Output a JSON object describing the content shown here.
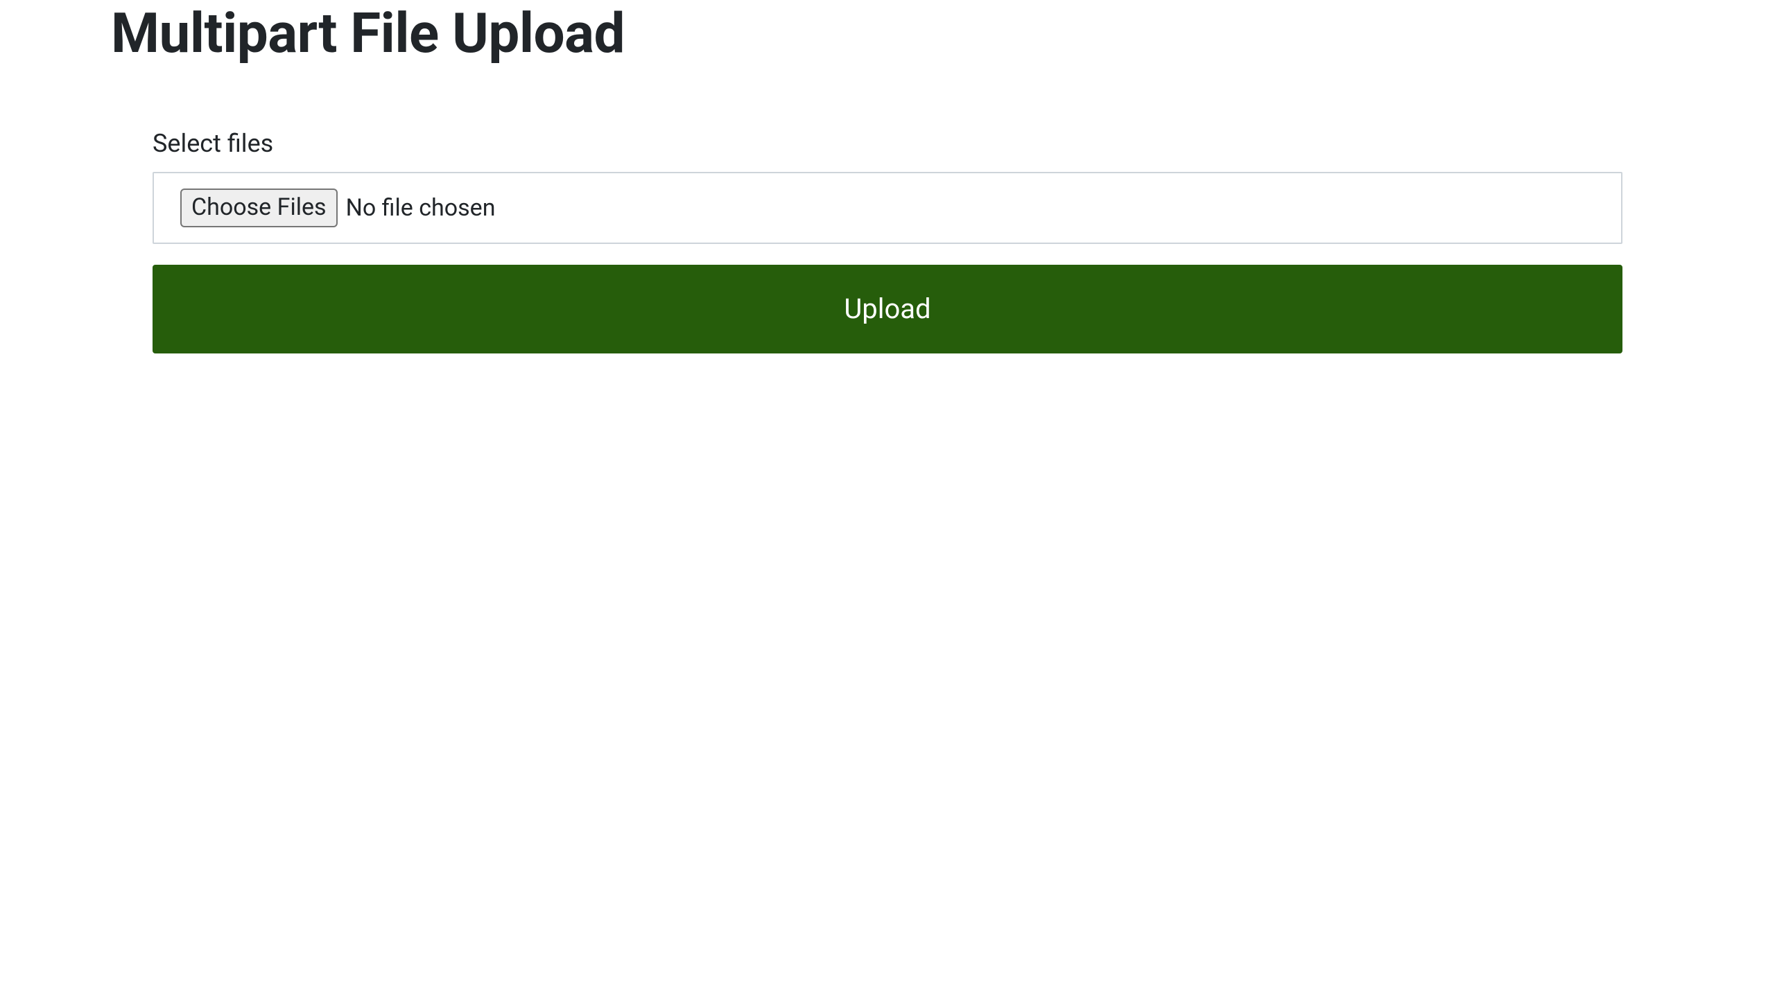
{
  "header": {
    "title": "Multipart File Upload"
  },
  "form": {
    "label": "Select files",
    "choose_button_label": "Choose Files",
    "file_status": "No file chosen",
    "upload_button_label": "Upload"
  },
  "colors": {
    "upload_button_bg": "#265d0b",
    "upload_button_fg": "#ffffff",
    "border": "#ced4da",
    "text": "#212529"
  }
}
